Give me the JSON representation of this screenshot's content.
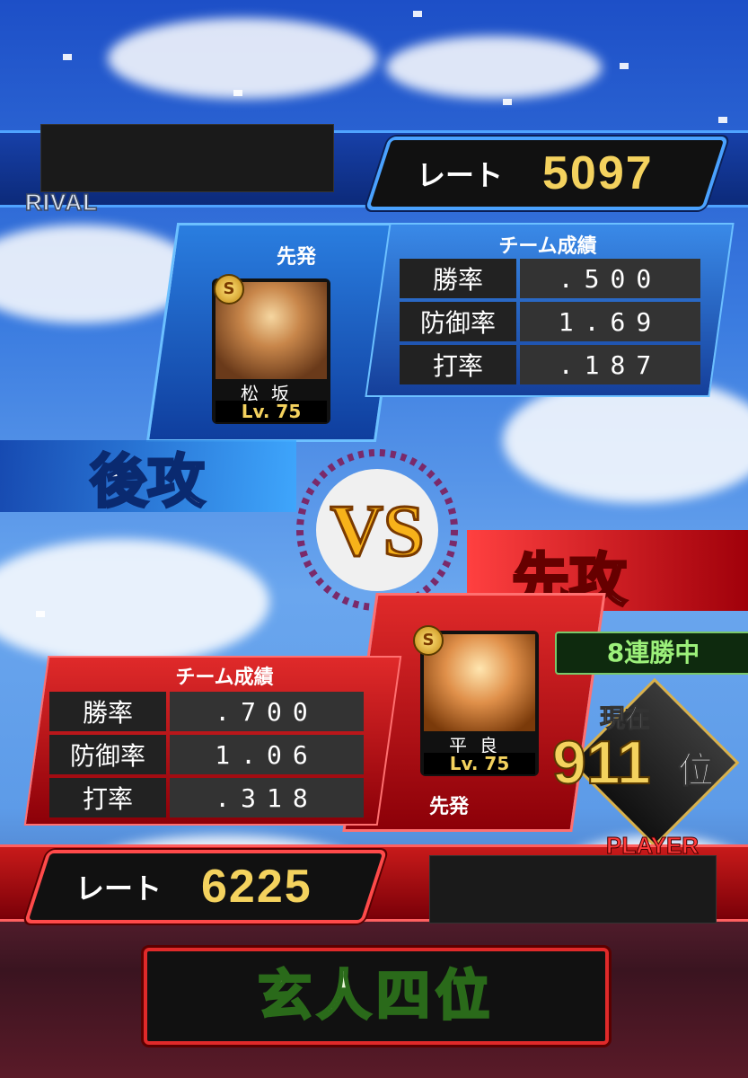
{
  "rival": {
    "tag": "RIVAL",
    "rate_label": "レート",
    "rate_value": "5097",
    "pitcher_role": "先発",
    "team_stats_title": "チーム成績",
    "stats": [
      {
        "label": "勝率",
        "value": ".500"
      },
      {
        "label": "防御率",
        "value": "1.69"
      },
      {
        "label": "打率",
        "value": ".187"
      }
    ],
    "player": {
      "name": "松坂",
      "level": "Lv. 75",
      "badge": "S"
    },
    "turn": "後攻"
  },
  "player": {
    "tag": "PLAYER",
    "rate_label": "レート",
    "rate_value": "6225",
    "pitcher_role": "先発",
    "team_stats_title": "チーム成績",
    "stats": [
      {
        "label": "勝率",
        "value": ".700"
      },
      {
        "label": "防御率",
        "value": "1.06"
      },
      {
        "label": "打率",
        "value": ".318"
      }
    ],
    "player": {
      "name": "平良",
      "level": "Lv. 75",
      "badge": "S"
    },
    "turn": "先攻",
    "win_streak": "8連勝中",
    "rank_prefix": "現在",
    "rank_number": "911",
    "rank_suffix": "位"
  },
  "vs_label": "VS",
  "rank_title": "玄人四位",
  "colors": {
    "accent_blue": "#4aa2ff",
    "accent_red": "#e0242a",
    "gold": "#f4d25e"
  }
}
